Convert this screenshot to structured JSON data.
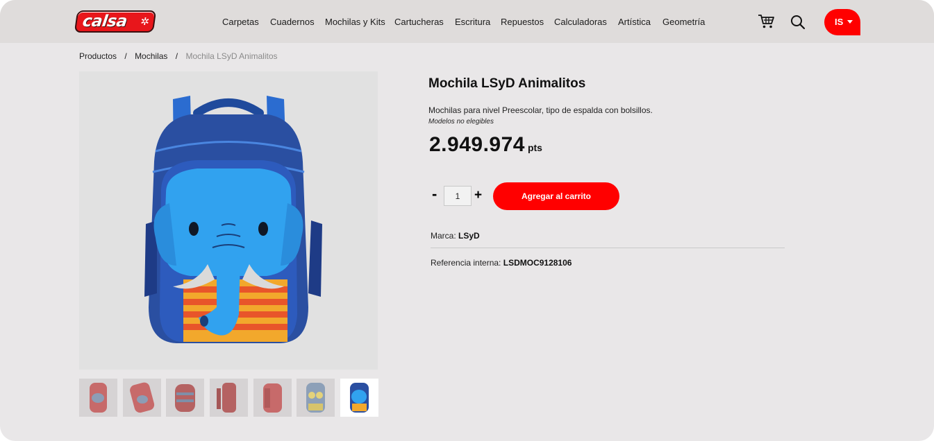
{
  "header": {
    "logo_text": "calsa",
    "nav": [
      "Carpetas",
      "Cuadernos",
      "Mochilas y Kits",
      "Cartucheras",
      "Escritura",
      "Repuestos",
      "Calculadoras",
      "Artística",
      "Geometría"
    ],
    "user_initials": "IS"
  },
  "breadcrumb": {
    "items": [
      "Productos",
      "Mochilas"
    ],
    "separator": "/",
    "current": "Mochila LSyD Animalitos"
  },
  "product": {
    "title": "Mochila LSyD Animalitos",
    "description": "Mochilas para nivel Preescolar, tipo de espalda con bolsillos.",
    "models_note": "Modelos no elegibles",
    "price": "2.949.974",
    "price_unit": "pts",
    "quantity": "1",
    "qty_minus": "-",
    "qty_plus": "+",
    "add_to_cart_label": "Agregar al carrito",
    "brand_label": "Marca:",
    "brand_value": "LSyD",
    "reference_label": "Referencia interna:",
    "reference_value": "LSDMOC9128106"
  },
  "colors": {
    "accent": "#ff0000",
    "header_bg": "#dfdcdb",
    "page_bg": "#e9e7e8",
    "backpack_blue": "#2456a8"
  },
  "icons": {
    "cart": "cart-icon",
    "search": "search-icon",
    "user_caret": "caret-down-icon"
  }
}
